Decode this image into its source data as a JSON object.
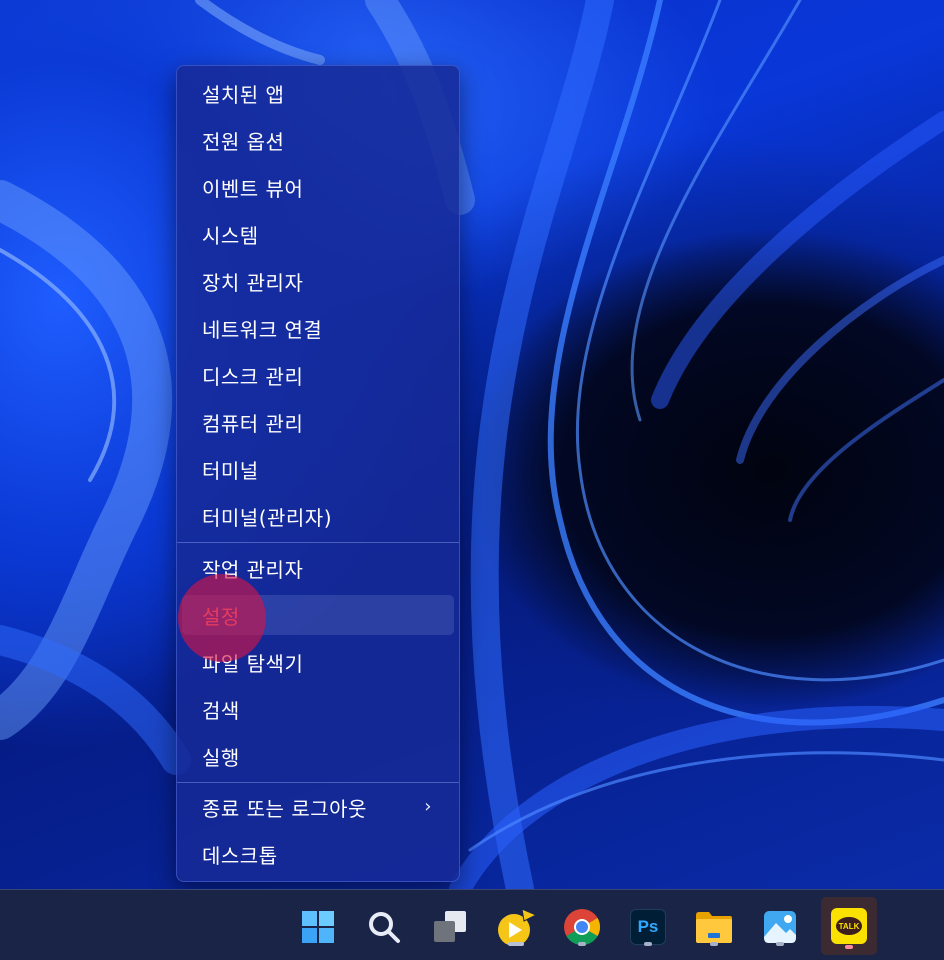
{
  "context_menu": {
    "items": [
      {
        "label": "설치된 앱"
      },
      {
        "label": "전원 옵션"
      },
      {
        "label": "이벤트 뷰어"
      },
      {
        "label": "시스템"
      },
      {
        "label": "장치 관리자"
      },
      {
        "label": "네트워크 연결"
      },
      {
        "label": "디스크 관리"
      },
      {
        "label": "컴퓨터 관리"
      },
      {
        "label": "터미널"
      },
      {
        "label": "터미널(관리자)"
      },
      {
        "label": "작업 관리자"
      },
      {
        "label": "설정"
      },
      {
        "label": "파일 탐색기"
      },
      {
        "label": "검색"
      },
      {
        "label": "실행"
      },
      {
        "label": "종료 또는 로그아웃",
        "submenu_icon": "chevron-right-icon"
      },
      {
        "label": "데스크톱"
      }
    ],
    "hovered_item": "설정"
  },
  "taskbar": {
    "icons": [
      {
        "name": "windows-start-icon"
      },
      {
        "name": "search-icon"
      },
      {
        "name": "task-view-icon"
      },
      {
        "name": "media-player-icon",
        "running": true
      },
      {
        "name": "chrome-icon",
        "running": true
      },
      {
        "name": "photoshop-icon",
        "label": "Ps",
        "running": true
      },
      {
        "name": "file-explorer-icon",
        "running": true
      },
      {
        "name": "photos-icon",
        "running": true
      },
      {
        "name": "kakaotalk-icon",
        "label": "TALK",
        "running": true,
        "active": true
      }
    ]
  },
  "colors": {
    "menu_background": "#162a96",
    "hover_text": "#ff7a8a",
    "taskbar_background": "#1a2446",
    "click_indicator": "#d71446"
  }
}
